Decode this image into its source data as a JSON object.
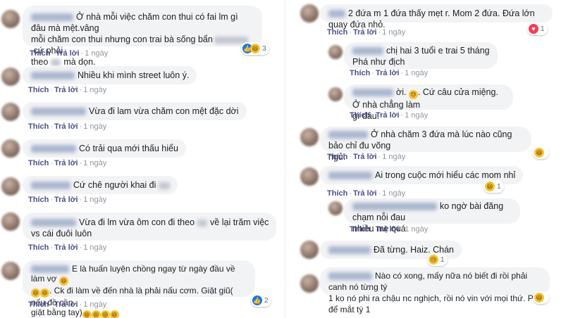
{
  "actions": {
    "like": "Thích",
    "reply": "Trả lời",
    "sep": "·",
    "time": "1 ngày"
  },
  "left": [
    {
      "lines": [
        "Ở nhà mỗi việc chăm con thui có fai lm gì đâu mà mệt.vâng",
        "mỗi chăm con thui nhưng con trai bà sống bẩn",
        ".cứ phải",
        "theo",
        "mà dọn."
      ],
      "reaction": {
        "icons": [
          "like",
          "haha"
        ],
        "count": "3"
      }
    },
    {
      "lines": [
        "Nhiều khi mình street luôn ý."
      ]
    },
    {
      "lines": [
        "Vừa đi lam vừa chăm con mệt đặc dời"
      ]
    },
    {
      "lines": [
        "Có trải qua mới thấu hiểu"
      ]
    },
    {
      "lines": [
        "Cứ chê người khai đi"
      ]
    },
    {
      "lines": [
        "Vừa đi lm vừa ôm con đi theo",
        "về lại trăm việc",
        "vs cái đuôi luôn"
      ]
    },
    {
      "lines": [
        "E là huấn luyện chồng ngay từ ngày đầu về làm vợ",
        ". Ck đi làm về đến nhà là phải nấu cơm. Giặt giũ( nếu đồ cần",
        "giặt bằng tay)"
      ],
      "reaction": {
        "icons": [
          "like"
        ],
        "count": "2"
      }
    }
  ],
  "right": [
    {
      "lines": [
        "2 đứa m 1 đứa thấy mẹt r. Mom 2 đứa. Đứa lớn quay đứa nhỏ."
      ],
      "reaction": {
        "icons": [
          "love"
        ],
        "count": "1"
      }
    },
    {
      "lines": [
        "chị hai 3 tuổi e trai 5 tháng",
        "Phá như địch"
      ]
    },
    {
      "lines": [
        "ời.",
        ". Cứ câu cửa miệng. Ở nhà chẳng làm",
        "gì đâu."
      ]
    },
    {
      "lines": [
        "Ở nhà chăm 3 đứa mà lúc nào cũng bảo chỉ đu võng",
        "ngủ."
      ],
      "reaction": {
        "icons": [
          "haha"
        ],
        "count": ""
      }
    },
    {
      "lines": [
        "Ai trong cuộc mới hiểu các mom nhỉ"
      ],
      "reaction": {
        "icons": [
          "haha"
        ],
        "count": "1"
      }
    },
    {
      "lines": [
        "ko ngờ bài đăng chạm nỗi đau",
        "nhiều mẹ quá"
      ]
    },
    {
      "lines": [
        "Đã từng. Haiz. Chán"
      ],
      "reaction": {
        "icons": [
          "sad"
        ],
        "count": "1"
      }
    },
    {
      "lines": [
        "Nào có xong, mấy nữa nó biết đi rồi phải canh nó từng tý",
        "1 ko nó phi ra chậu nc nghịch, rồi nó vin với mọi thứ. P để mắt tý 1"
      ],
      "reaction": {
        "icons": [
          "haha"
        ],
        "count": ""
      }
    }
  ],
  "colors": {
    "bubble": "#f2f3f5",
    "link": "#4b4f8f",
    "meta": "#90949c",
    "like": "#1877f2",
    "haha": "#f7c536"
  }
}
